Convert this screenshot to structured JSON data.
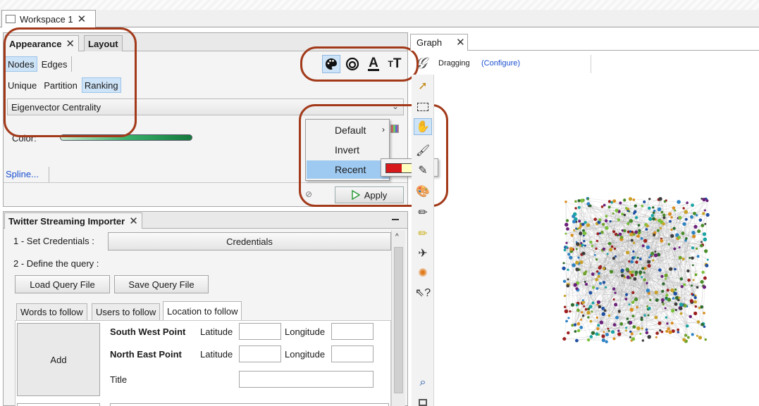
{
  "workspace": {
    "tab_label": "Workspace 1"
  },
  "appearance": {
    "tabs": [
      {
        "label": "Appearance"
      },
      {
        "label": "Layout"
      }
    ],
    "element_toggles": [
      {
        "label": "Nodes",
        "selected": true
      },
      {
        "label": "Edges",
        "selected": false
      }
    ],
    "mode_toggles": [
      {
        "label": "Unique",
        "selected": false
      },
      {
        "label": "Partition",
        "selected": false
      },
      {
        "label": "Ranking",
        "selected": true
      }
    ],
    "transformer_icons": [
      "palette-icon",
      "size-icon",
      "label-color-icon",
      "label-size-icon"
    ],
    "attribute_select": {
      "value": "Eigenvector Centrality"
    },
    "color_label": "Color:",
    "spline_link": "Spline...",
    "apply_label": "Apply",
    "menu": {
      "items": [
        {
          "label": "Default"
        },
        {
          "label": "Invert"
        },
        {
          "label": "Recent",
          "selected": true
        }
      ]
    },
    "recent_palette": [
      "#d7191c",
      "#ffffbf",
      "#2c7bb6"
    ],
    "highlight_color": "#a23a1a"
  },
  "twitter": {
    "title": "Twitter Streaming Importer",
    "step1_label": "1 - Set Credentials :",
    "credentials_button": "Credentials",
    "step2_label": "2 - Define the query :",
    "load_button": "Load Query File",
    "save_button": "Save Query File",
    "tabs": [
      {
        "label": "Words to follow"
      },
      {
        "label": "Users to follow"
      },
      {
        "label": "Location to follow",
        "active": true
      }
    ],
    "add_button": "Add",
    "sw_label": "South West Point",
    "ne_label": "North East Point",
    "latitude_label": "Latitude",
    "longitude_label": "Longitude",
    "title_label": "Title"
  },
  "graph": {
    "tab_label": "Graph",
    "mode_label": "Dragging",
    "configure_link": "(Configure)",
    "node_colors": [
      "#2e6b2e",
      "#4a8c2a",
      "#6fa32b",
      "#c9a227",
      "#d98e1f",
      "#1f4fa3",
      "#2f83c4",
      "#1aa3a3",
      "#9c1f1f",
      "#6a1f7a",
      "#3d3d3d",
      "#7bbf3a"
    ]
  }
}
